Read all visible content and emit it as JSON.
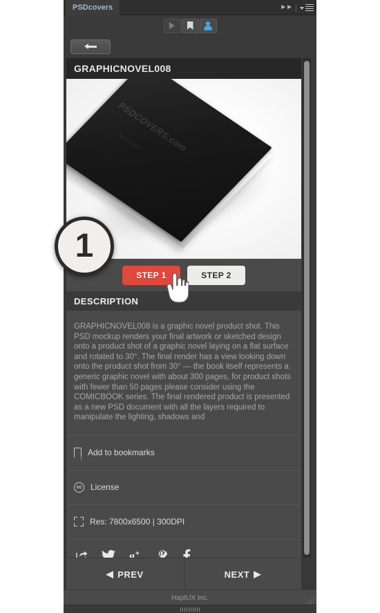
{
  "panel": {
    "tab_label": "PSDcovers",
    "collapse_icon": "double-chevron-right-icon",
    "menu_icon": "panel-menu-icon"
  },
  "toolbar": {
    "buttons": [
      {
        "name": "play-button",
        "icon": "play-triangle-icon",
        "label": ""
      },
      {
        "name": "bookmarks-button",
        "icon": "bookmark-icon",
        "label": ""
      },
      {
        "name": "account-button",
        "icon": "person-icon",
        "label": ""
      }
    ]
  },
  "navigation": {
    "back_icon": "arrow-left-icon"
  },
  "product": {
    "title": "GRAPHICNOVEL008",
    "image_alt": "black graphic novel book mockup",
    "watermark": "PSDCOVERS.com",
    "watermark_sub": "psdcovers"
  },
  "steps": {
    "badge_number": "1",
    "step1_label": "STEP 1",
    "step2_label": "STEP 2",
    "primary_color": "#e0483d",
    "cursor_icon": "hand-pointer-icon"
  },
  "description": {
    "heading": "DESCRIPTION",
    "body": "GRAPHICNOVEL008 is a graphic novel product shot. This PSD mockup renders your final artwork or sketched design onto a product shot of a graphic novel laying on a flat surface and rotated to 30°.  The final render has a view looking down onto the product shot from 30° — the book itself represents a generic graphic novel with about 300 pages, for product shots with fewer than 50 pages please consider using the COMICBOOK series. The final rendered product is presented as a new PSD document with all the layers required to manipulate the lighting, shadows and"
  },
  "meta_rows": [
    {
      "name": "add-to-bookmarks-row",
      "icon": "bookmark-outline-icon",
      "label": "Add to bookmarks"
    },
    {
      "name": "license-row",
      "icon": "creative-commons-icon",
      "label": "License",
      "icon_text": "cc"
    },
    {
      "name": "resolution-row",
      "icon": "crop-corners-icon",
      "label": "Res: 7800x6500 | 300DPI"
    }
  ],
  "social": [
    {
      "name": "share-icon",
      "label": "Share"
    },
    {
      "name": "twitter-icon",
      "label": "Twitter"
    },
    {
      "name": "google-plus-icon",
      "label": "Google Plus"
    },
    {
      "name": "pinterest-icon",
      "label": "Pinterest"
    },
    {
      "name": "facebook-icon",
      "label": "Facebook"
    }
  ],
  "pager": {
    "prev_label": "PREV",
    "next_label": "NEXT",
    "prev_icon": "triangle-left-icon",
    "next_icon": "triangle-right-icon"
  },
  "footer": {
    "credit": "HaptUX Inc.",
    "resize_grip": "resize-grip-icon"
  }
}
